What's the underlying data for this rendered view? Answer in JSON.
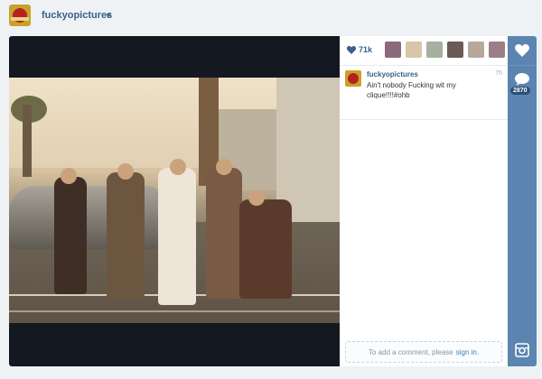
{
  "header": {
    "username": "fuckyopictures"
  },
  "post": {
    "likes_count": "71k",
    "comment": {
      "username": "fuckyopictures",
      "time": "7h",
      "text": "Ain't nobody Fucking wit my clique!!!!#ohb"
    },
    "add_comment_prompt": "To add a comment, please",
    "sign_in_label": "sign in."
  },
  "rail": {
    "comment_count": "2870"
  },
  "colors": {
    "accent": "#3a5f8a",
    "rail": "#5b85b0",
    "link": "#3a80c0"
  },
  "icons": [
    "chevron-down-icon",
    "heart-icon",
    "comment-icon",
    "instagram-icon"
  ]
}
